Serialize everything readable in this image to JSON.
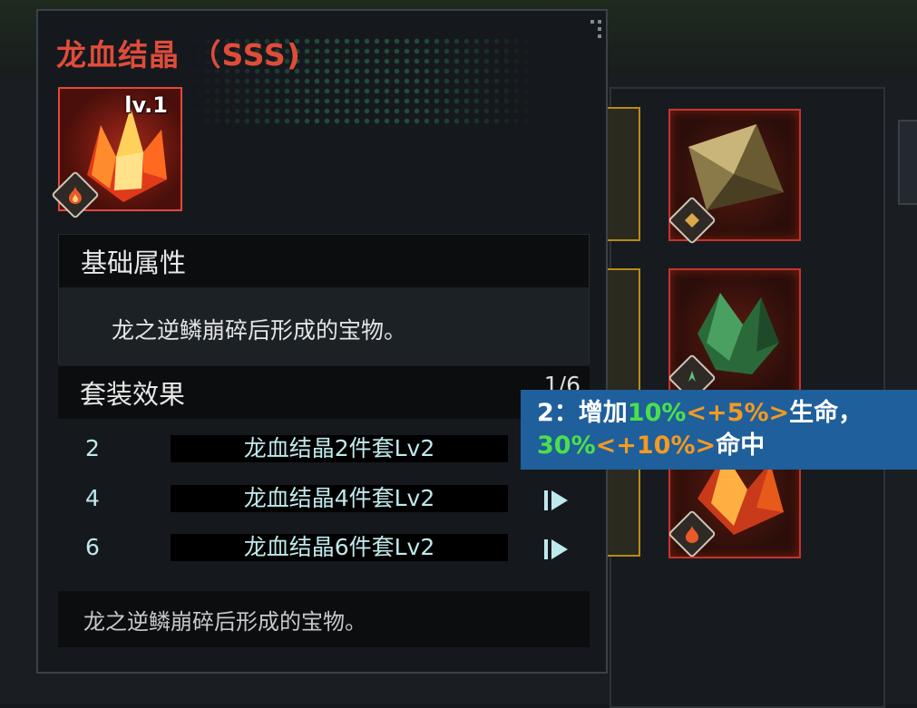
{
  "tooltip": {
    "title": "龙血结晶 （SSS)",
    "level": "lv.1",
    "base_section": {
      "heading": "基础属性",
      "description": "龙之逆鳞崩碎后形成的宝物。"
    },
    "set_section": {
      "heading": "套装效果",
      "count": "1/6",
      "rows": [
        {
          "pieces": "2",
          "name": "龙血结晶2件套Lv2"
        },
        {
          "pieces": "4",
          "name": "龙血结晶4件套Lv2"
        },
        {
          "pieces": "6",
          "name": "龙血结晶6件套Lv2"
        }
      ]
    },
    "footer": "龙之逆鳞崩碎后形成的宝物。"
  },
  "effect_popup": {
    "prefix": "2：增加",
    "hp_value": "10%",
    "hp_bonus": "<+5%>",
    "hp_suffix": "生命，",
    "hit_value": "30%",
    "hit_bonus": "<+10%>",
    "hit_suffix": "命中"
  },
  "colors": {
    "title": "#e04c3a",
    "set_text": "#bfe9ec",
    "popup_bg": "#1f5f9b",
    "value_green": "#4be04b",
    "bonus_orange": "#f29a21"
  },
  "icons": [
    "dragon-blood-crystal-icon",
    "fire-badge-icon",
    "play-icon",
    "dot-grid-icon"
  ]
}
